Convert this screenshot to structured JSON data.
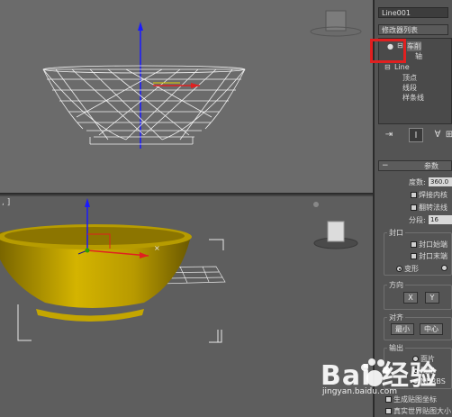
{
  "viewport_persp": {
    "label": ", ]"
  },
  "panel": {
    "object_name": "Line001",
    "modifier_list": "修改器列表",
    "stack": {
      "lathe": "车削",
      "axis": "轴",
      "line": "Line",
      "vertex": "顶点",
      "segment": "线段",
      "spline": "样条线"
    },
    "toolbar": [
      "⇥",
      "I",
      "∀",
      "⊞"
    ],
    "params_title": "参数",
    "degrees_label": "度数:",
    "degrees_value": "360.0",
    "weld_core": "焊接内核",
    "flip_normals": "翻转法线",
    "segments_label": "分段:",
    "segments_value": "16",
    "capping": "封口",
    "cap_start": "封口始端",
    "cap_end": "封口末端",
    "morph": "变形",
    "direction": "方向",
    "dir_x": "X",
    "dir_y": "Y",
    "align": "对齐",
    "align_min": "最小",
    "align_center": "中心",
    "output": "输出",
    "out_patch": "面片",
    "out_mesh": "网格",
    "out_nurbs": "NURBS",
    "gen_mapping": "生成贴图坐标",
    "real_world": "真实世界贴图大小"
  },
  "watermark": {
    "logo": "Bai  经验",
    "url": "jingyan.baidu.com"
  },
  "colors": {
    "bowl": "#b59a00",
    "highlight": "#e02020",
    "axis_blue": "#1a1aff"
  }
}
